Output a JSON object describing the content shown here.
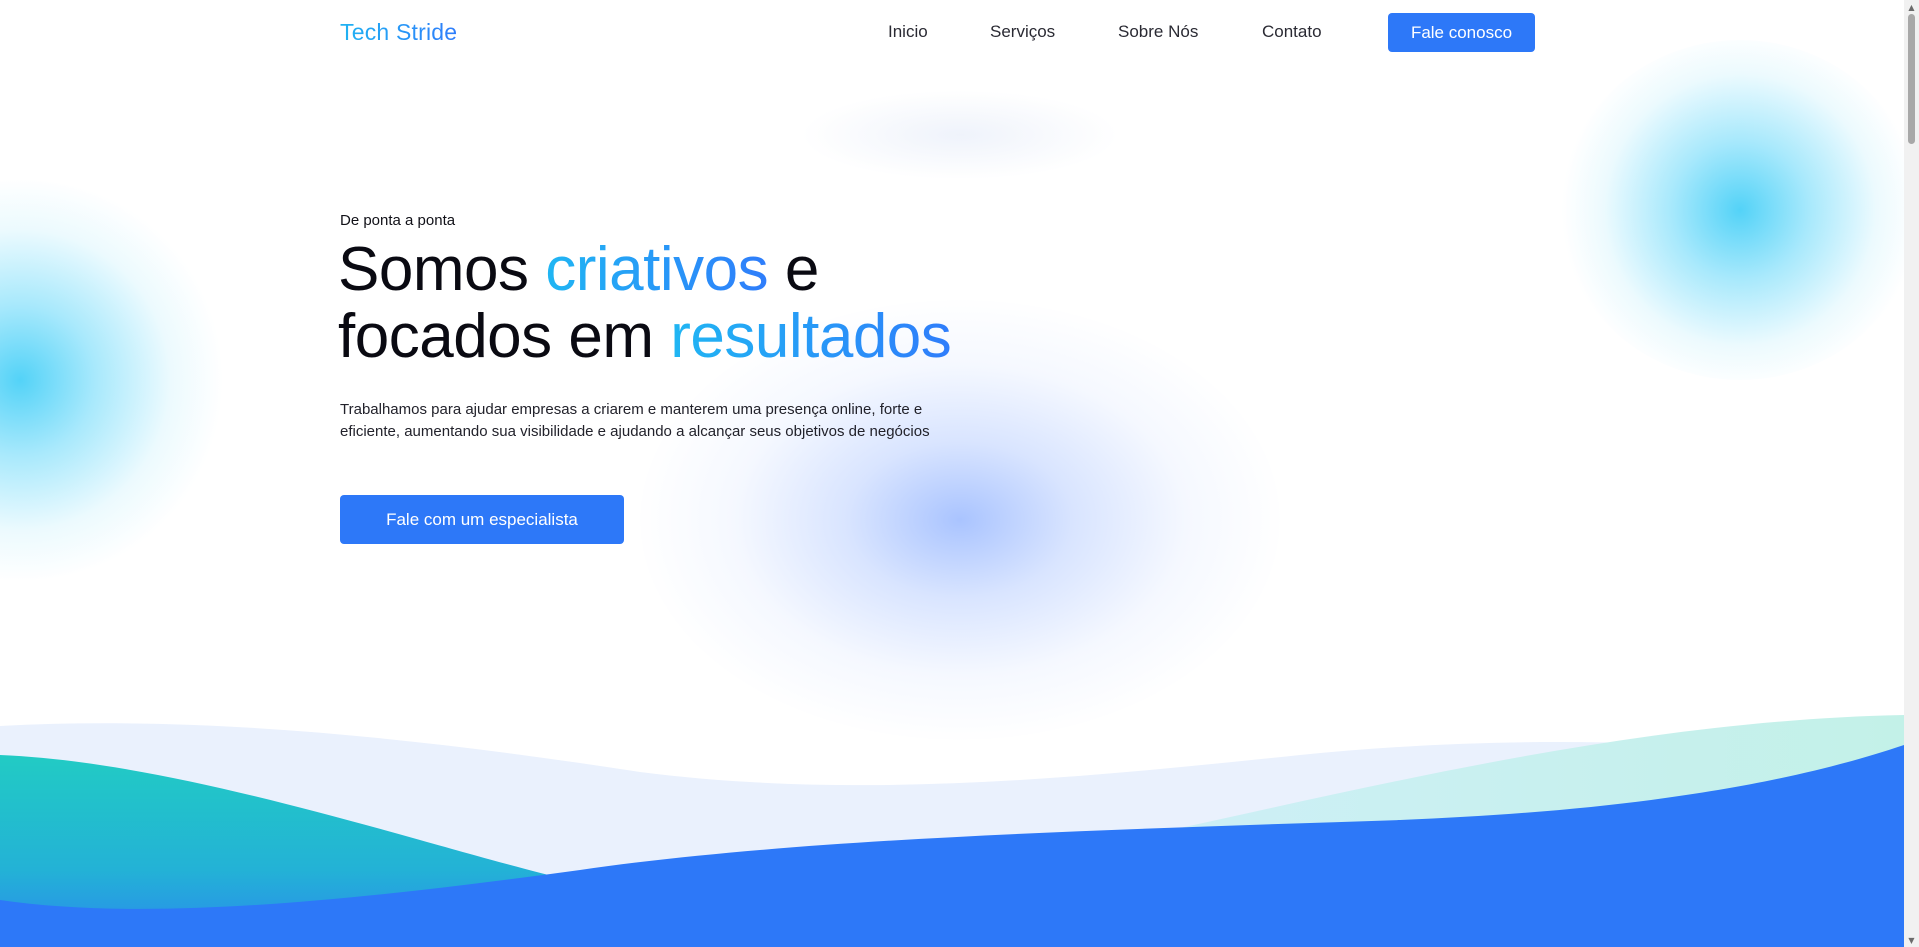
{
  "brand": {
    "name": "Tech Stride",
    "gradient_start": "#1fb3f2",
    "gradient_end": "#2f7dfb"
  },
  "nav": {
    "items": [
      {
        "label": "Inicio"
      },
      {
        "label": "Serviços"
      },
      {
        "label": "Sobre Nós"
      },
      {
        "label": "Contato"
      }
    ],
    "cta_label": "Fale conosco"
  },
  "hero": {
    "eyebrow": "De ponta a ponta",
    "headline": {
      "part1": "Somos ",
      "highlight1": "criativos",
      "part2": " e",
      "part3": "focados em ",
      "highlight2": "resultados"
    },
    "description": "Trabalhamos para ajudar empresas a criarem e manterem uma presença online, forte e eficiente, aumentando sua visibilidade e ajudando a alcançar seus objetivos de negócios",
    "cta_label": "Fale com um especialista"
  },
  "colors": {
    "primary": "#2d78f8",
    "teal": "#22cbc4",
    "cyan_glow": "#4ad0f7",
    "light_wave": "#eaf1fd",
    "text_dark": "#0a0a12"
  },
  "icons": {
    "scroll_up": "▲",
    "scroll_down": "▼"
  }
}
